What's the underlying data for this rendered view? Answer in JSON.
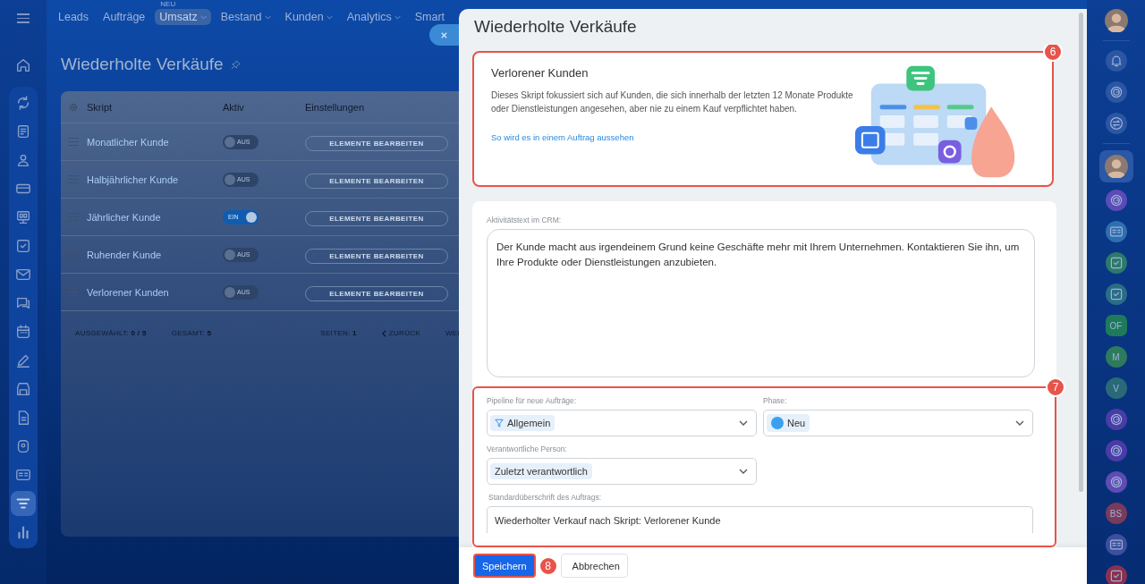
{
  "top_nav": {
    "items": [
      {
        "label": "Leads",
        "dropdown": false,
        "selected": false
      },
      {
        "label": "Aufträge",
        "dropdown": false,
        "selected": false
      },
      {
        "label": "Umsatz",
        "badge": "NEU",
        "dropdown": true,
        "selected": true
      },
      {
        "label": "Bestand",
        "dropdown": true,
        "selected": false
      },
      {
        "label": "Kunden",
        "dropdown": true,
        "selected": false
      },
      {
        "label": "Analytics",
        "dropdown": true,
        "selected": false
      },
      {
        "label": "Smart",
        "dropdown": false,
        "selected": false
      }
    ]
  },
  "left_sidebar": {
    "items": [
      {
        "kind": "home",
        "selected": false
      },
      {
        "kind": "sync",
        "selected": false
      },
      {
        "kind": "document",
        "selected": false
      },
      {
        "kind": "people",
        "selected": false
      },
      {
        "kind": "card",
        "selected": false
      },
      {
        "kind": "board",
        "selected": false
      },
      {
        "kind": "task",
        "selected": false
      },
      {
        "kind": "mail",
        "selected": false
      },
      {
        "kind": "chat",
        "selected": false
      },
      {
        "kind": "calendar",
        "selected": false
      },
      {
        "kind": "pen",
        "selected": false
      },
      {
        "kind": "store",
        "selected": false
      },
      {
        "kind": "file",
        "selected": false
      },
      {
        "kind": "box",
        "selected": false
      },
      {
        "kind": "idcard",
        "selected": false
      },
      {
        "kind": "funnel",
        "selected": true
      },
      {
        "kind": "chart",
        "selected": false
      }
    ]
  },
  "page": {
    "title": "Wiederholte Verkäufe"
  },
  "table": {
    "columns": [
      "Skript",
      "Aktiv",
      "Einstellungen"
    ],
    "rows": [
      {
        "name": "Monatlicher Kunde",
        "on": false,
        "toggle_label": "AUS",
        "button": "ELEMENTE BEARBEITEN"
      },
      {
        "name": "Halbjährlicher Kunde",
        "on": false,
        "toggle_label": "AUS",
        "button": "ELEMENTE BEARBEITEN"
      },
      {
        "name": "Jährlicher Kunde",
        "on": true,
        "toggle_label": "EIN",
        "button": "ELEMENTE BEARBEITEN"
      },
      {
        "name": "Ruhender Kunde",
        "on": false,
        "toggle_label": "AUS",
        "button": "ELEMENTE BEARBEITEN"
      },
      {
        "name": "Verlorener Kunden",
        "on": false,
        "toggle_label": "AUS",
        "button": "ELEMENTE BEARBEITEN"
      }
    ],
    "footer": {
      "selected_label": "AUSGEWÄHLT:",
      "selected_value": "0 / 5",
      "total_label": "GESAMT:",
      "total_value": "5",
      "pages_label": "SEITEN:",
      "pages_value": "1",
      "prev": "ZURÜCK",
      "next": "WEI"
    }
  },
  "panel": {
    "title": "Wiederholte Verkäufe",
    "intro": {
      "callout": "6",
      "title": "Verlorener Kunden",
      "text": "Dieses Skript fokussiert sich auf Kunden, die sich innerhalb der letzten 12 Monate Produkte oder Dienstleistungen angesehen, aber nie zu einem Kauf verpflichtet haben.",
      "link": "So wird es in einem Auftrag aussehen"
    },
    "activity": {
      "label": "Aktivitätstext im CRM:",
      "value": "Der Kunde macht aus irgendeinem Grund keine Geschäfte mehr mit Ihrem Unternehmen. Kontaktieren Sie ihn, um Ihre Produkte oder Dienstleistungen anzubieten."
    },
    "fields_callout": "7",
    "pipeline": {
      "label": "Pipeline für neue Aufträge:",
      "value": "Allgemein"
    },
    "phase": {
      "label": "Phase:",
      "value": "Neu"
    },
    "responsible": {
      "label": "Verantwortliche Person:",
      "value": "Zuletzt verantwortlich"
    },
    "deal_title": {
      "label": "Standardüberschrift des Auftrags:",
      "value": "Wiederholter Verkauf nach Skript: Verlorener Kunde"
    },
    "buttons": [
      {
        "label": "Speichern",
        "kind": "primary",
        "callout": "8"
      },
      {
        "label": "Abbrechen",
        "kind": "secondary"
      }
    ]
  },
  "right_bar": {
    "items": [
      {
        "kind": "photo",
        "selected": false
      },
      {
        "kind": "bell",
        "color": "#2b56a3",
        "selected": false
      },
      {
        "kind": "spiral",
        "color": "#2b56a3",
        "selected": false
      },
      {
        "kind": "swap",
        "color": "#2b56a3",
        "selected": false
      },
      {
        "kind": "photo",
        "selected": true
      },
      {
        "kind": "spiral",
        "color": "#5b4bb8",
        "selected": false
      },
      {
        "kind": "idcard",
        "color": "#2e6fb0",
        "selected": false
      },
      {
        "kind": "task",
        "color": "#2c7a6a",
        "selected": false
      },
      {
        "kind": "task",
        "color": "#2a6d86",
        "selected": false
      },
      {
        "kind": "hexagon",
        "text": "OF",
        "color": "#1e7a5a",
        "selected": false
      },
      {
        "kind": "letter",
        "text": "M",
        "color": "#2e7a5c",
        "selected": false
      },
      {
        "kind": "letter",
        "text": "V",
        "color": "#2a6a78",
        "selected": false
      },
      {
        "kind": "spiral",
        "color": "#4a3ca8",
        "selected": false
      },
      {
        "kind": "spiral",
        "color": "#4a3ca8",
        "selected": false
      },
      {
        "kind": "spiral",
        "color": "#5e4bb4",
        "selected": false
      },
      {
        "kind": "letter",
        "text": "BS",
        "color": "#7a3a5a",
        "selected": false
      },
      {
        "kind": "idcard",
        "color": "#3d4fa0",
        "selected": false
      },
      {
        "kind": "task",
        "color": "#8a3050",
        "selected": false
      }
    ]
  }
}
